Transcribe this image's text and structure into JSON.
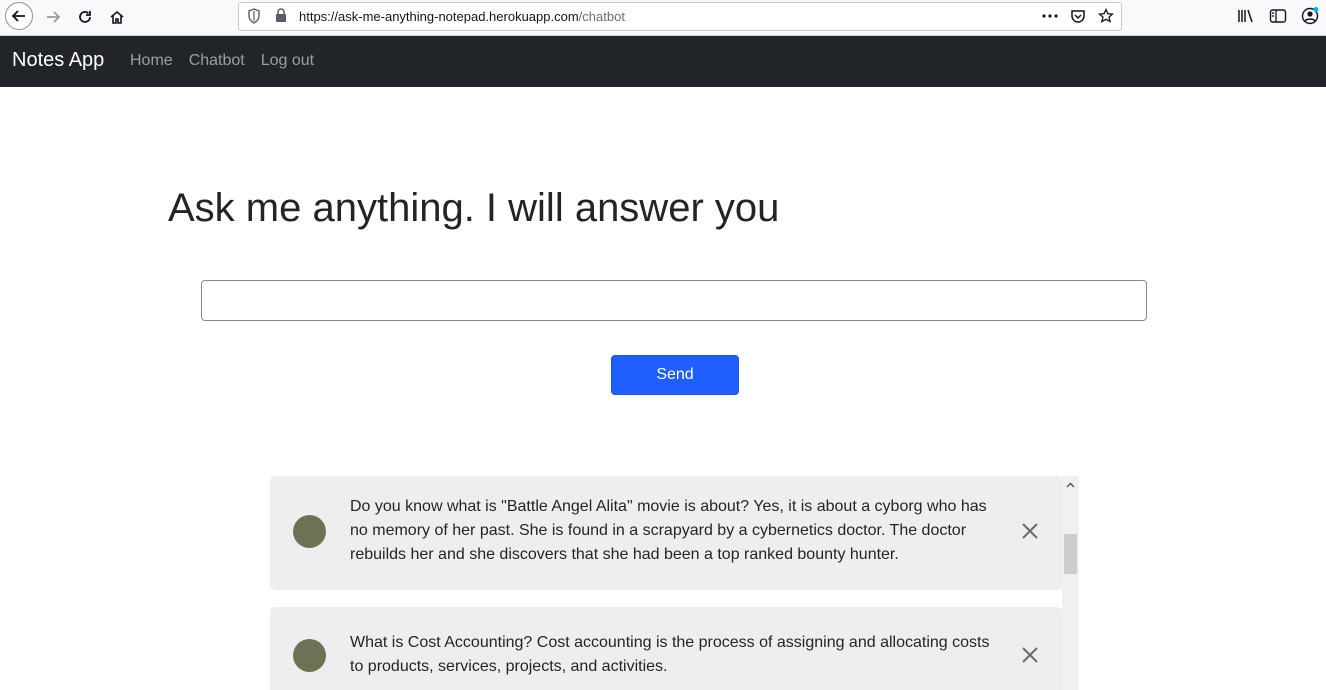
{
  "browser": {
    "url_host": "https://ask-me-anything-notepad.herokuapp.com",
    "url_path": "/chatbot"
  },
  "navbar": {
    "brand": "Notes App",
    "links": [
      "Home",
      "Chatbot",
      "Log out"
    ]
  },
  "main": {
    "heading": "Ask me anything. I will answer you",
    "input_value": "",
    "send_label": "Send"
  },
  "messages": [
    {
      "text": "Do you know what is \"Battle Angel Alita\" movie is about? Yes, it is about a cyborg who has no memory of her past. She is found in a scrapyard by a cybernetics doctor. The doctor rebuilds her and she discovers that she had been a top ranked bounty hunter."
    },
    {
      "text": "What is Cost Accounting? Cost accounting is the process of assigning and allocating costs to products, services, projects, and activities."
    }
  ],
  "colors": {
    "navbar_bg": "#212529",
    "send_button": "#1f5fff",
    "card_bg": "#eeeeee",
    "avatar": "#6e7254"
  }
}
